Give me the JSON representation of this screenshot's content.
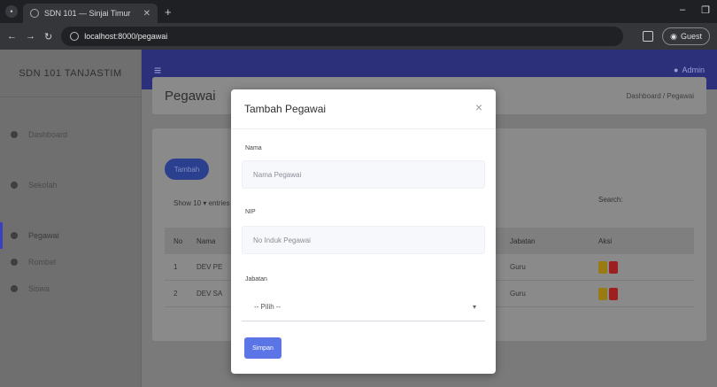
{
  "browser": {
    "tab_title": "SDN 101 — Sinjai Timur",
    "new_tab": "+",
    "url": "localhost:8000/pegawai",
    "guest_label": "Guest"
  },
  "sidebar": {
    "brand": "SDN 101 TANJASTIM",
    "items": [
      {
        "label": "Dashboard",
        "icon": "dashboard-icon"
      },
      {
        "label": "Sekolah",
        "icon": "school-icon"
      },
      {
        "label": "Pegawai",
        "icon": "user-icon"
      },
      {
        "label": "Rombel",
        "icon": "group-icon"
      },
      {
        "label": "Siswa",
        "icon": "student-icon"
      }
    ]
  },
  "topnav": {
    "admin_label": "Admin"
  },
  "page": {
    "title": "Pegawai",
    "breadcrumb": "Dashboard / Pegawai"
  },
  "card": {
    "add_button": "Tambah",
    "show_label": "Show  10  ▾  entries",
    "search_label": "Search:",
    "columns": [
      "No",
      "Nama",
      "Jabatan",
      "Aksi"
    ],
    "rows": [
      {
        "no": "1",
        "nama": "DEV PE",
        "jabatan": "Guru"
      },
      {
        "no": "2",
        "nama": "DEV SA",
        "jabatan": "Guru"
      }
    ]
  },
  "modal": {
    "title": "Tambah Pegawai",
    "close": "×",
    "nama_label": "Nama",
    "nama_placeholder": "Nama Pegawai",
    "nip_label": "NIP",
    "nip_placeholder": "No Induk Pegawai",
    "jabatan_label": "Jabatan",
    "jabatan_selected": "-- Pilih --",
    "save_label": "Simpan"
  }
}
